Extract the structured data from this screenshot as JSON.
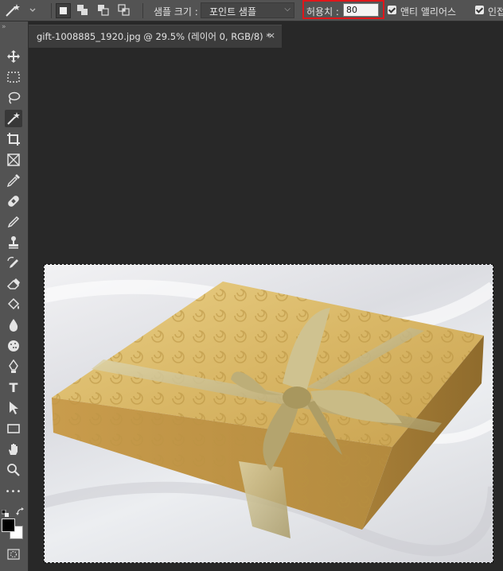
{
  "options_bar": {
    "sample_size_label": "샘플 크기 :",
    "sample_size_value": "포인트 샘플",
    "tolerance_label": "허용치 :",
    "tolerance_value": "80",
    "anti_alias_label": "앤티 앨리어스",
    "contiguous_label": "인접"
  },
  "document_tab": {
    "title": "gift-1008885_1920.jpg @ 29.5% (레이어 0, RGB/8) *",
    "close_glyph": "×"
  },
  "toolbox": {
    "collapse_glyph": "»",
    "type_tool_glyph": "T",
    "more_glyph": "•••"
  },
  "highlight_color": "#e0161a"
}
